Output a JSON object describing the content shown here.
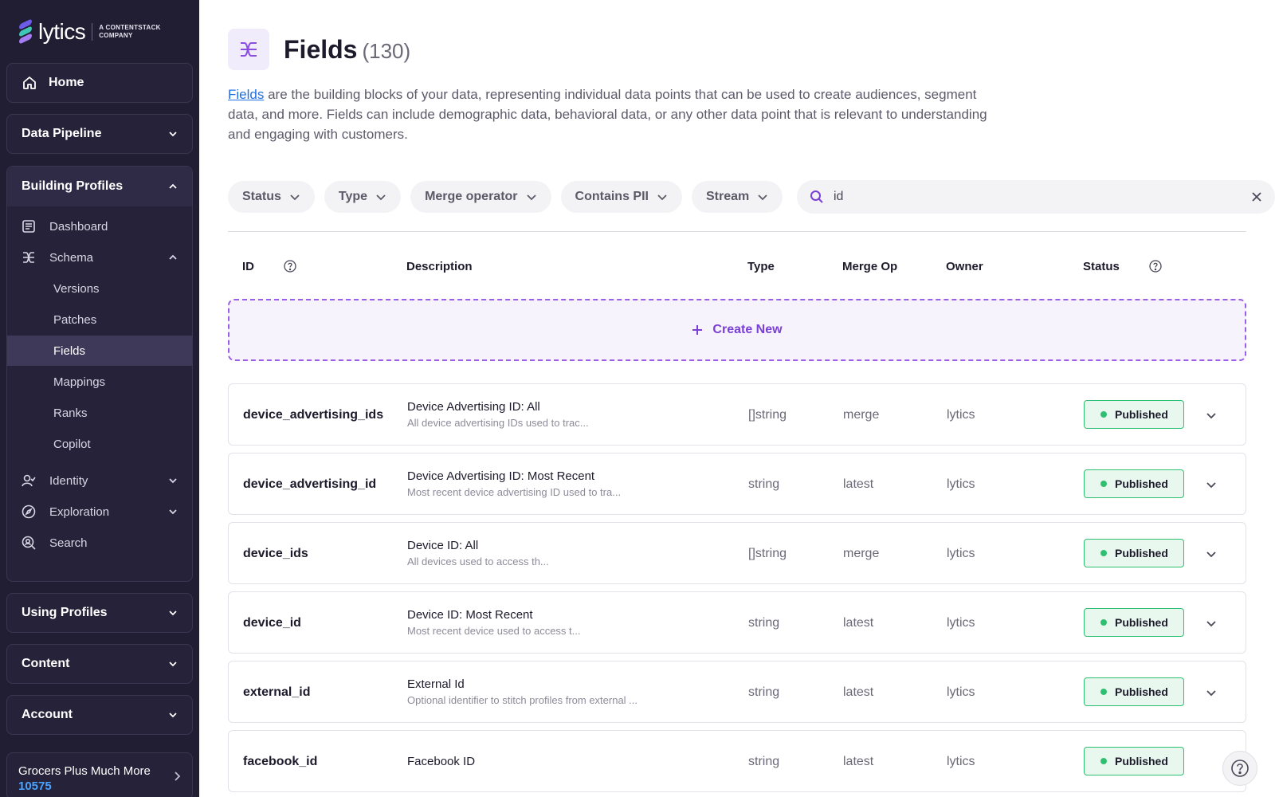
{
  "brand": {
    "name": "lytics",
    "tagline_line1": "A CONTENTSTACK",
    "tagline_line2": "COMPANY"
  },
  "sidebar": {
    "home": "Home",
    "data_pipeline": "Data Pipeline",
    "building_profiles": {
      "label": "Building Profiles",
      "items": {
        "dashboard": "Dashboard",
        "schema": "Schema",
        "versions": "Versions",
        "patches": "Patches",
        "fields": "Fields",
        "mappings": "Mappings",
        "ranks": "Ranks",
        "copilot": "Copilot",
        "identity": "Identity",
        "exploration": "Exploration",
        "search": "Search"
      }
    },
    "using_profiles": "Using Profiles",
    "content": "Content",
    "account": "Account",
    "account_box": {
      "name": "Grocers Plus Much More",
      "id": "10575"
    }
  },
  "page": {
    "title": "Fields",
    "count": "(130)",
    "intro_link": "Fields",
    "intro_text": " are the building blocks of your data, representing individual data points that can be used to create audiences, segment data, and more. Fields can include demographic data, behavioral data, or any other data point that is relevant to understanding and engaging with customers."
  },
  "filters": {
    "status": "Status",
    "type": "Type",
    "merge_operator": "Merge operator",
    "contains_pii": "Contains PII",
    "stream": "Stream",
    "search_value": "id"
  },
  "table": {
    "headers": {
      "id": "ID",
      "description": "Description",
      "type": "Type",
      "merge_op": "Merge Op",
      "owner": "Owner",
      "status": "Status"
    },
    "create_new": "Create New",
    "rows": [
      {
        "id": "device_advertising_ids",
        "title": "Device Advertising ID: All",
        "subtitle": "All device advertising IDs used to trac...",
        "type": "[]string",
        "merge": "merge",
        "owner": "lytics",
        "status": "Published"
      },
      {
        "id": "device_advertising_id",
        "title": "Device Advertising ID: Most Recent",
        "subtitle": "Most recent device advertising ID used to tra...",
        "type": "string",
        "merge": "latest",
        "owner": "lytics",
        "status": "Published"
      },
      {
        "id": "device_ids",
        "title": "Device ID: All",
        "subtitle": "All devices used to access th...",
        "type": "[]string",
        "merge": "merge",
        "owner": "lytics",
        "status": "Published"
      },
      {
        "id": "device_id",
        "title": "Device ID: Most Recent",
        "subtitle": "Most recent device used to access t...",
        "type": "string",
        "merge": "latest",
        "owner": "lytics",
        "status": "Published"
      },
      {
        "id": "external_id",
        "title": "External Id",
        "subtitle": "Optional identifier to stitch profiles from external ...",
        "type": "string",
        "merge": "latest",
        "owner": "lytics",
        "status": "Published"
      },
      {
        "id": "facebook_id",
        "title": "Facebook ID",
        "subtitle": "",
        "type": "string",
        "merge": "latest",
        "owner": "lytics",
        "status": "Published"
      }
    ]
  },
  "colors": {
    "sidebar_bg": "#211d33",
    "accent_purple": "#7a3fd6",
    "published_green": "#2fbf71",
    "link_blue": "#1f6fe5"
  }
}
